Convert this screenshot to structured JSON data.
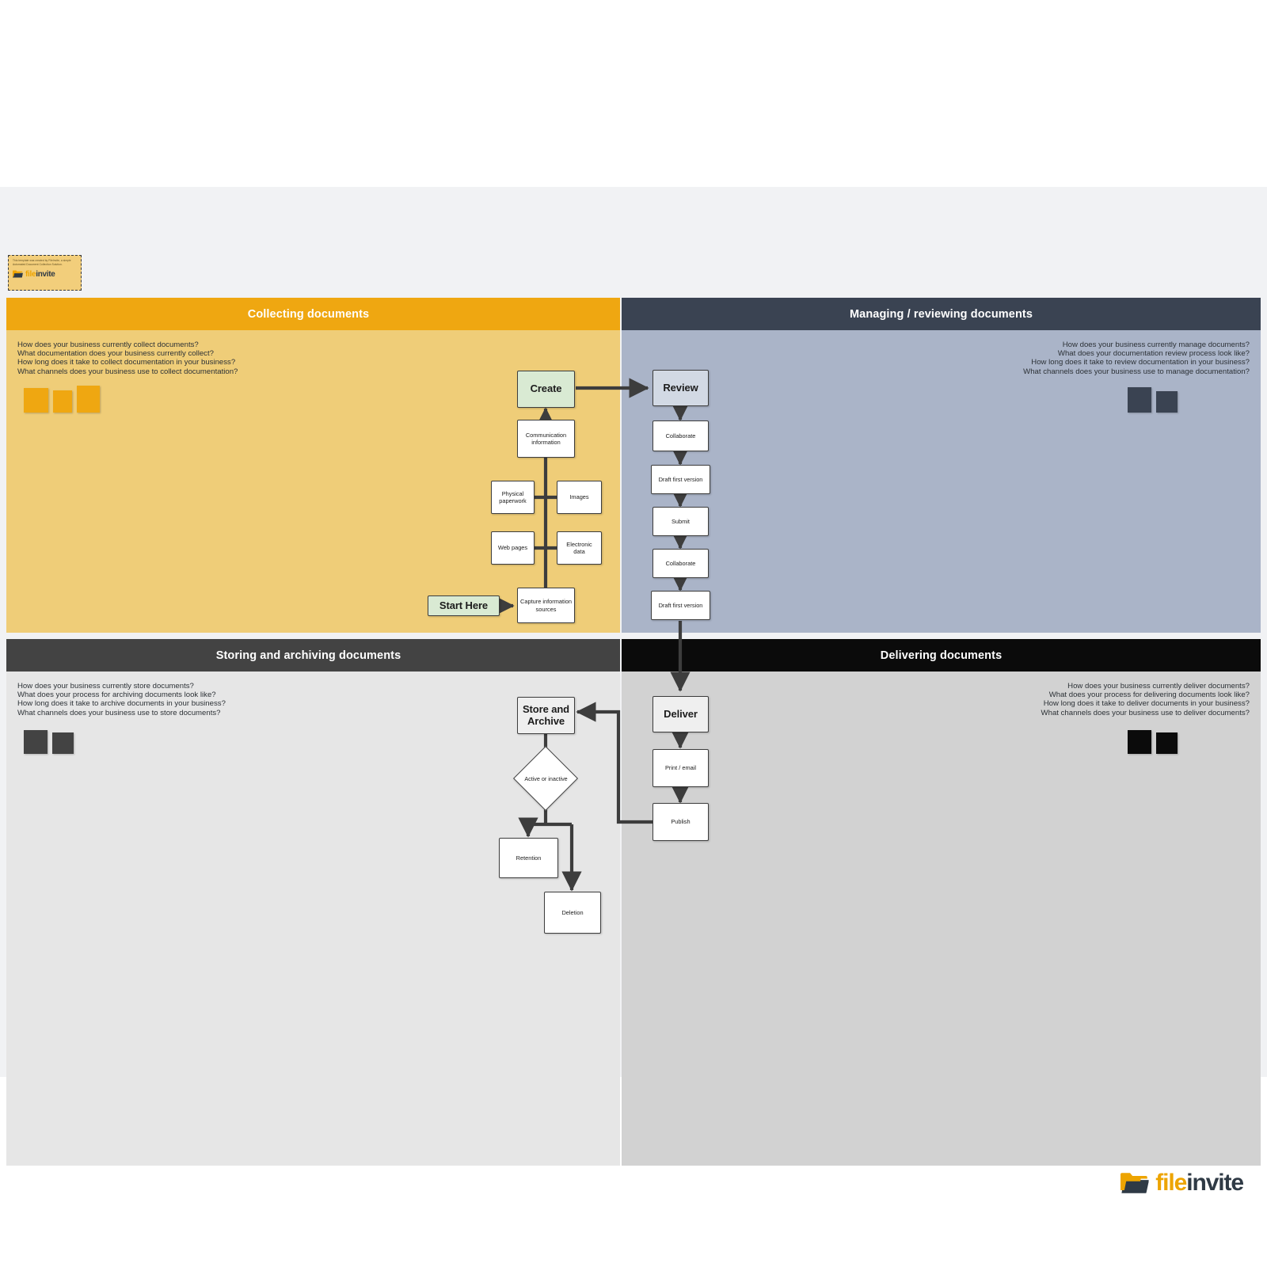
{
  "promo": {
    "blurb": "This template was created by FileInvite, a simple Automated Document Collection Solution.",
    "brand_first": "file",
    "brand_second": "invite",
    "icon": "folder-icon"
  },
  "brand_footer": {
    "first": "file",
    "second": "invite",
    "icon": "folder-icon"
  },
  "colors": {
    "collect_header": "#EFA711",
    "collect_body": "#EFCD78",
    "manage_header": "#3A4352",
    "manage_body": "#AAB4C8",
    "store_header": "#434343",
    "store_body": "#E6E6E6",
    "deliver_header": "#0B0B0B",
    "deliver_body": "#D2D2D2",
    "canvas": "#F1F2F4",
    "accent_orange": "#EDA400",
    "node_green": "#D9EAD3",
    "node_bluegrey": "#D2D9E4"
  },
  "quadrants": [
    {
      "id": "collecting",
      "title": "Collecting documents",
      "questions": "How does your business currently collect documents?\nWhat documentation does your business currently collect?\nHow long does it take to collect documentation in your business?\nWhat channels does your business use to collect documentation?",
      "chips": [
        "#EFA711",
        "#EFA711",
        "#EFA711"
      ]
    },
    {
      "id": "managing",
      "title": "Managing / reviewing documents",
      "questions": "How does your business currently manage documents?\nWhat does your documentation review process look like?\nHow long does it take to review documentation in your business?\nWhat channels does your business use to manage documentation?",
      "chips": [
        "#3A4352",
        "#3A4352"
      ]
    },
    {
      "id": "storing",
      "title": "Storing and archiving documents",
      "questions": "How does your business currently store documents?\nWhat does your process for archiving documents look like?\nHow long does it take to archive documents in your business?\nWhat channels does your business use to store documents?",
      "chips": [
        "#434343",
        "#434343"
      ]
    },
    {
      "id": "delivering",
      "title": "Delivering documents",
      "questions": "How does your business currently deliver documents?\nWhat does your process for delivering documents look like?\nHow long does it take to deliver documents in your business?\nWhat channels does your business use to deliver documents?",
      "chips": [
        "#0B0B0B",
        "#0B0B0B"
      ]
    }
  ],
  "flow": {
    "start": "Start Here",
    "create": "Create",
    "review": "Review",
    "store_archive": "Store and\nArchive",
    "deliver": "Deliver",
    "capture_sources": "Capture information\nsources",
    "communication_information": "Communication\ninformation",
    "physical_paperwork": "Physical\npaperwork",
    "images": "Images",
    "web_pages": "Web pages",
    "electronic_data": "Electronic\ndata",
    "collaborate_1": "Collaborate",
    "draft_first_version_1": "Draft first version",
    "submit": "Submit",
    "collaborate_2": "Collaborate",
    "draft_first_version_2": "Draft first version",
    "print_email": "Print / email",
    "publish": "Publish",
    "active_or_inactive": "Active or inactive",
    "retention": "Retention",
    "deletion": "Deletion"
  }
}
